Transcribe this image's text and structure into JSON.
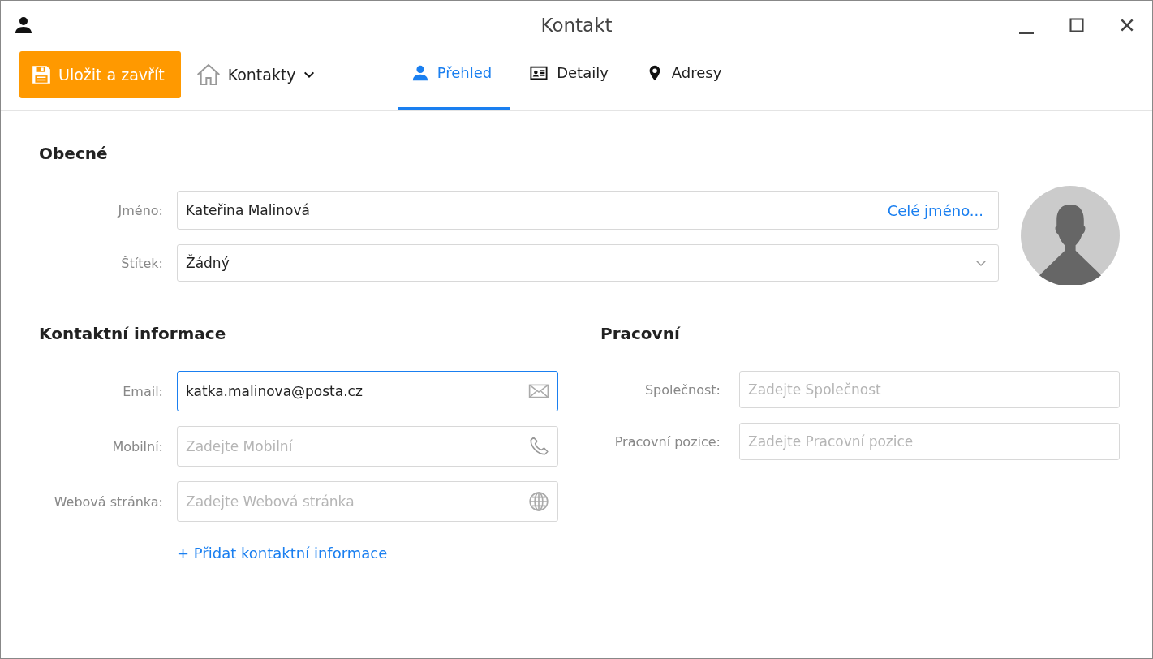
{
  "window": {
    "title": "Kontakt"
  },
  "toolbar": {
    "save_button": "Uložit a zavřít",
    "contacts_menu": "Kontakty"
  },
  "tabs": [
    {
      "label": "Přehled",
      "kind": "person",
      "selected": true
    },
    {
      "label": "Detaily",
      "kind": "card",
      "selected": false
    },
    {
      "label": "Adresy",
      "kind": "pin",
      "selected": false
    }
  ],
  "general": {
    "heading": "Obecné",
    "name": {
      "label": "Jméno:",
      "value": "Kateřina Malinová",
      "button": "Celé jméno..."
    },
    "tag": {
      "label": "Štítek:",
      "value": "Žádný"
    }
  },
  "contact_info": {
    "heading": "Kontaktní informace",
    "fields": [
      {
        "kind": "email",
        "label": "Email:",
        "value": "katka.malinova@posta.cz",
        "focused": true
      },
      {
        "kind": "phone",
        "label": "Mobilní:",
        "placeholder": "Zadejte Mobilní",
        "focused": false
      },
      {
        "kind": "web",
        "label": "Webová stránka:",
        "placeholder": "Zadejte Webová stránka",
        "focused": false
      }
    ],
    "add_link": "+ Přidat kontaktní informace"
  },
  "work": {
    "heading": "Pracovní",
    "fields": [
      {
        "label": "Společnost:",
        "placeholder": "Zadejte Společnost"
      },
      {
        "label": "Pracovní pozice:",
        "placeholder": "Zadejte Pracovní pozice"
      }
    ]
  }
}
